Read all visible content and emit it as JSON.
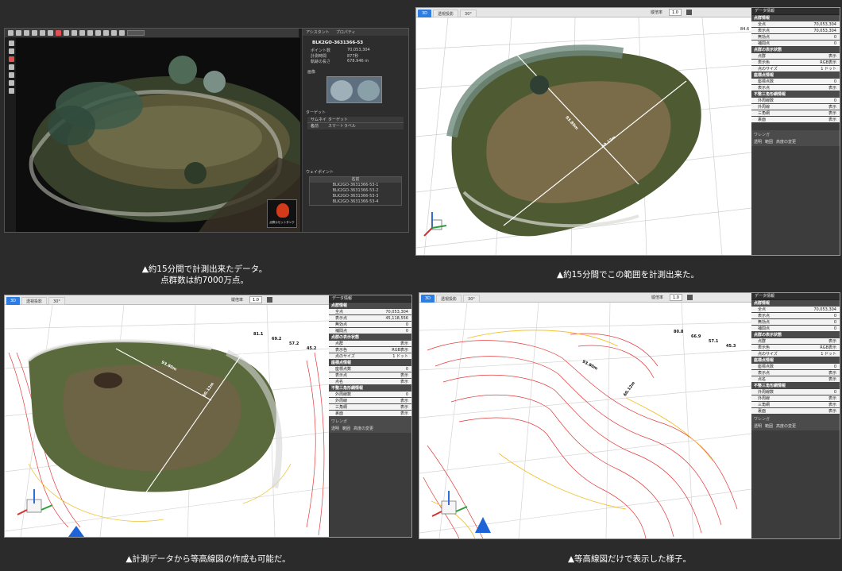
{
  "captions": {
    "top_left_line1": "▲約15分間で計測出来たデータ。",
    "top_left_line2": "点群数は約7000万点。",
    "top_right": "▲約15分間でこの範囲を計測出来た。",
    "bottom_left": "▲計測データから等高線図の作成も可能だ。",
    "bottom_right": "▲等高線図だけで表示した様子。"
  },
  "viewer1": {
    "menu": [
      "アシスタント",
      "プロパティ"
    ],
    "scan_name": "BLK2GO-3631366-53",
    "props": [
      {
        "k": "ポイント数",
        "v": "70,053,304"
      },
      {
        "k": "計測時間",
        "v": "877秒"
      },
      {
        "k": "軌跡の長さ",
        "v": "678.946 m"
      }
    ],
    "image_label": "画像",
    "target_label": "ターゲット",
    "target_cols": [
      "サムネイル",
      "ターゲット"
    ],
    "target_row": [
      "名前",
      "スマートラベル"
    ],
    "waypoint_label": "ウェイポイント",
    "waypoint_header": "名前",
    "waypoints": [
      "BLK2GO-3631366-53-1",
      "BLK2GO-3631366-53-2",
      "BLK2GO-3631366-53-3",
      "BLK2GO-3631366-53-4"
    ],
    "badge": "点群カセットタンク"
  },
  "viewer2": {
    "tabs": [
      "3D",
      "透視投影",
      "30°"
    ],
    "zoom_label": "縦倍率",
    "zoom_value": "1.0",
    "panel_title": "データ情報",
    "sections": [
      {
        "title": "点群情報",
        "rows": [
          [
            "全点",
            "70,053,304"
          ],
          [
            "表示点",
            "70,053,304"
          ],
          [
            "無効点",
            "0"
          ],
          [
            "補間点",
            "0"
          ]
        ]
      },
      {
        "title": "点群の表示状態",
        "rows": [
          [
            "点群",
            "表示"
          ],
          [
            "表示色",
            "RGB表示"
          ],
          [
            "点のサイズ",
            "1 ドット"
          ]
        ]
      },
      {
        "title": "座標点情報",
        "rows": [
          [
            "座標点数",
            "0"
          ],
          [
            "表示点",
            "表示"
          ]
        ]
      },
      {
        "title": "不整三角形網情報",
        "rows": [
          [
            "外周線数",
            "0"
          ],
          [
            "外周線",
            "表示"
          ],
          [
            "三角網",
            "表示"
          ],
          [
            "裏面",
            "表示"
          ]
        ]
      }
    ],
    "footer_title": "ワレンガ",
    "footer_buttons": [
      "透明",
      "範囲",
      "高度の変更"
    ],
    "axis_value": "84.6",
    "measure1": "93.80m",
    "measure2": "60.12m"
  },
  "viewer3": {
    "tabs": [
      "3D",
      "透視投影",
      "30°"
    ],
    "zoom_label": "縦倍率",
    "zoom_value": "1.0",
    "panel_title": "データ情報",
    "sections": [
      {
        "title": "点群情報",
        "rows": [
          [
            "全点",
            "70,053,304"
          ],
          [
            "表示点",
            "45,118,556"
          ],
          [
            "無効点",
            "0"
          ],
          [
            "補間点",
            "0"
          ]
        ]
      },
      {
        "title": "点群の表示状態",
        "rows": [
          [
            "点群",
            "表示"
          ],
          [
            "表示色",
            "RGB表示"
          ],
          [
            "点のサイズ",
            "1 ドット"
          ]
        ]
      },
      {
        "title": "座標点情報",
        "rows": [
          [
            "座標点数",
            "0"
          ],
          [
            "表示点",
            "表示"
          ],
          [
            "点名",
            "表示"
          ]
        ]
      },
      {
        "title": "不整三角形網情報",
        "rows": [
          [
            "外周線数",
            "0"
          ],
          [
            "外周線",
            "表示"
          ],
          [
            "三角網",
            "表示"
          ],
          [
            "裏面",
            "表示"
          ]
        ]
      }
    ],
    "footer_title": "ワレンガ",
    "footer_buttons": [
      "透明",
      "範囲",
      "高度の変更"
    ],
    "contour_labels": [
      "81.1",
      "69.2",
      "57.2",
      "45.2"
    ],
    "measure1": "93.80m",
    "measure2": "60.12m"
  },
  "viewer4": {
    "tabs": [
      "3D",
      "透視投影",
      "30°"
    ],
    "zoom_label": "縦倍率",
    "zoom_value": "1.0",
    "panel_title": "データ情報",
    "sections": [
      {
        "title": "点群情報",
        "rows": [
          [
            "全点",
            "70,053,304"
          ],
          [
            "表示点",
            "0"
          ],
          [
            "無効点",
            "0"
          ],
          [
            "補間点",
            "0"
          ]
        ]
      },
      {
        "title": "点群の表示状態",
        "rows": [
          [
            "点群",
            "表示"
          ],
          [
            "表示色",
            "RGB表示"
          ],
          [
            "点のサイズ",
            "1 ドット"
          ]
        ]
      },
      {
        "title": "座標点情報",
        "rows": [
          [
            "座標点数",
            "0"
          ],
          [
            "表示点",
            "表示"
          ],
          [
            "点名",
            "表示"
          ]
        ]
      },
      {
        "title": "不整三角形網情報",
        "rows": [
          [
            "外周線数",
            "0"
          ],
          [
            "外周線",
            "表示"
          ],
          [
            "三角網",
            "表示"
          ],
          [
            "裏面",
            "表示"
          ]
        ]
      }
    ],
    "footer_title": "ワレンガ",
    "footer_buttons": [
      "透明",
      "範囲",
      "高度の変更"
    ],
    "contour_labels": [
      "80.8",
      "66.9",
      "57.1",
      "45.3"
    ],
    "measure1": "93.80m",
    "measure2": "60.12m"
  }
}
